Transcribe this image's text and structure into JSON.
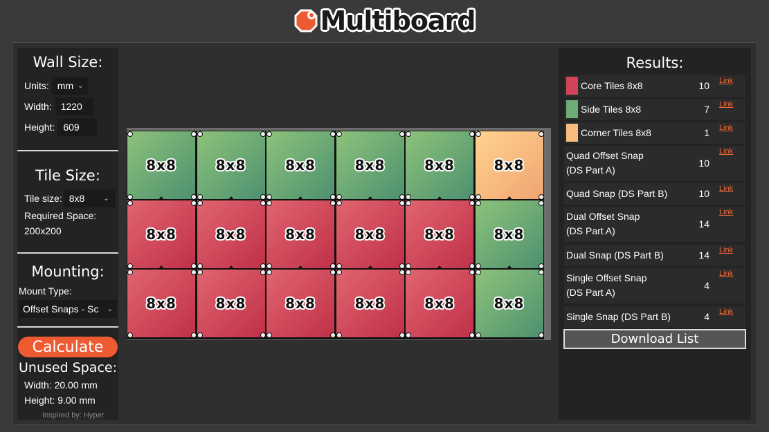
{
  "app": {
    "logo_text": "Multiboard",
    "brand_color": "#ee5a32"
  },
  "wall": {
    "title": "Wall Size:",
    "units_label": "Units:",
    "units_value": "mm",
    "width_label": "Width:",
    "width_value": "1220",
    "height_label": "Height:",
    "height_value": "609"
  },
  "tile": {
    "title": "Tile Size:",
    "size_label": "Tile size:",
    "size_value": "8x8",
    "required_label": "Required Space:",
    "required_value": "200x200"
  },
  "mounting": {
    "title": "Mounting:",
    "type_label": "Mount Type:",
    "type_value": "Offset Snaps - Sc"
  },
  "calculate_label": "Calculate",
  "unused": {
    "title": "Unused Space:",
    "width_text": "Width: 20.00 mm",
    "height_text": "Height: 9.00 mm"
  },
  "credit": "Inspired by: Hyper",
  "grid": {
    "tile_text": "8x8",
    "rows": [
      [
        "side",
        "side",
        "side",
        "side",
        "side",
        "corner"
      ],
      [
        "core",
        "core",
        "core",
        "core",
        "core",
        "side"
      ],
      [
        "core",
        "core",
        "core",
        "core",
        "core",
        "side"
      ]
    ],
    "colors": {
      "core": "#cf4458",
      "side": "#6fac76",
      "corner": "#f9bd80"
    }
  },
  "results": {
    "title": "Results:",
    "link_text": "Link",
    "items": [
      {
        "name": "Core Tiles 8x8",
        "count": "10",
        "swatch": "#cf4458"
      },
      {
        "name": "Side Tiles 8x8",
        "count": "7",
        "swatch": "#6fac76"
      },
      {
        "name": "Corner Tiles 8x8",
        "count": "1",
        "swatch": "#f9bd80"
      },
      {
        "name": "Quad Offset Snap\n (DS Part A)",
        "count": "10"
      },
      {
        "name": "Quad Snap (DS Part B)",
        "count": "10"
      },
      {
        "name": "Dual Offset Snap\n (DS Part A)",
        "count": "14"
      },
      {
        "name": "Dual Snap (DS Part B)",
        "count": "14"
      },
      {
        "name": "Single Offset Snap\n (DS Part A)",
        "count": "4"
      },
      {
        "name": "Single Snap (DS Part B)",
        "count": "4"
      }
    ],
    "download_label": "Download List"
  }
}
